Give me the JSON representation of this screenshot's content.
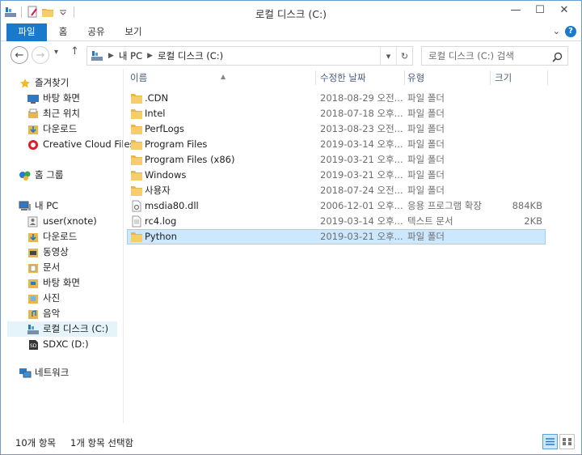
{
  "window": {
    "title": "로컬 디스크 (C:)",
    "controls": {
      "minimize": "—",
      "maximize": "☐",
      "close": "✕"
    }
  },
  "ribbon": {
    "tabs": [
      {
        "label": "파일"
      },
      {
        "label": "홈"
      },
      {
        "label": "공유"
      },
      {
        "label": "보기"
      }
    ],
    "collapse": "⌄",
    "help": "?"
  },
  "address": {
    "back": "←",
    "forward": "→",
    "recent": "▾",
    "up": "↑",
    "crumbs": [
      "내 PC",
      "로컬 디스크 (C:)"
    ],
    "dropdown": "▾",
    "refresh": "↻"
  },
  "search": {
    "placeholder": "로컬 디스크 (C:) 검색"
  },
  "nav": {
    "favorites": {
      "label": "즐겨찾기",
      "items": [
        {
          "label": "바탕 화면"
        },
        {
          "label": "최근 위치"
        },
        {
          "label": "다운로드"
        },
        {
          "label": "Creative Cloud Files"
        }
      ]
    },
    "homegroup": {
      "label": "홈 그룹"
    },
    "thispc": {
      "label": "내 PC",
      "items": [
        {
          "label": "user(xnote)"
        },
        {
          "label": "다운로드"
        },
        {
          "label": "동영상"
        },
        {
          "label": "문서"
        },
        {
          "label": "바탕 화면"
        },
        {
          "label": "사진"
        },
        {
          "label": "음악"
        },
        {
          "label": "로컬 디스크 (C:)"
        },
        {
          "label": "SDXC (D:)"
        }
      ]
    },
    "network": {
      "label": "네트워크"
    }
  },
  "columns": {
    "name": "이름",
    "date": "수정한 날짜",
    "type": "유형",
    "size": "크기"
  },
  "files": [
    {
      "name": ".CDN",
      "date": "2018-08-29 오전...",
      "type": "파일 폴더",
      "size": "",
      "icon": "folder-icon"
    },
    {
      "name": "Intel",
      "date": "2018-07-18 오후...",
      "type": "파일 폴더",
      "size": "",
      "icon": "folder-icon"
    },
    {
      "name": "PerfLogs",
      "date": "2013-08-23 오전...",
      "type": "파일 폴더",
      "size": "",
      "icon": "folder-icon"
    },
    {
      "name": "Program Files",
      "date": "2019-03-14 오후...",
      "type": "파일 폴더",
      "size": "",
      "icon": "folder-icon"
    },
    {
      "name": "Program Files (x86)",
      "date": "2019-03-21 오후...",
      "type": "파일 폴더",
      "size": "",
      "icon": "folder-icon"
    },
    {
      "name": "Windows",
      "date": "2019-03-21 오후...",
      "type": "파일 폴더",
      "size": "",
      "icon": "folder-icon"
    },
    {
      "name": "사용자",
      "date": "2018-07-24 오전...",
      "type": "파일 폴더",
      "size": "",
      "icon": "folder-icon"
    },
    {
      "name": "msdia80.dll",
      "date": "2006-12-01 오후...",
      "type": "응용 프로그램 확장",
      "size": "884KB",
      "icon": "dll-file-icon"
    },
    {
      "name": "rc4.log",
      "date": "2019-03-14 오후...",
      "type": "텍스트 문서",
      "size": "2KB",
      "icon": "text-file-icon"
    },
    {
      "name": "Python",
      "date": "2019-03-21 오후...",
      "type": "파일 폴더",
      "size": "",
      "icon": "folder-icon"
    }
  ],
  "status": {
    "count": "10개 항목",
    "selected": "1개 항목 선택함"
  },
  "colors": {
    "accent": "#1979ca",
    "folder": "#e8b64a",
    "selection": "#cce8ff",
    "selection_border": "#99d1ff",
    "header_text": "#4c607a"
  }
}
